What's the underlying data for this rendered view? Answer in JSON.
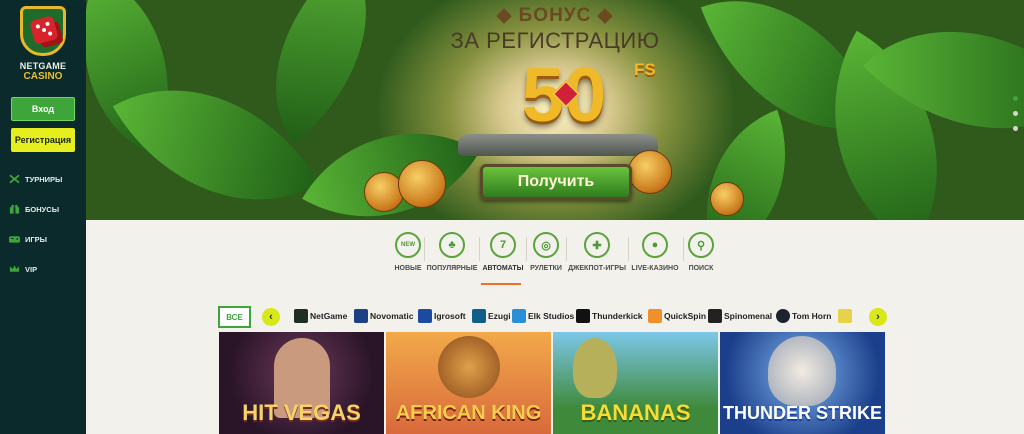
{
  "sidebar": {
    "logo_line1": "NETGAME",
    "logo_line2": "CASINO",
    "login_label": "Вход",
    "register_label": "Регистрация",
    "nav": [
      {
        "label": "ТУРНИРЫ",
        "icon": "tournament-icon"
      },
      {
        "label": "БОНУСЫ",
        "icon": "gift-icon"
      },
      {
        "label": "ИГРЫ",
        "icon": "games-icon"
      },
      {
        "label": "VIP",
        "icon": "crown-icon"
      }
    ]
  },
  "hero": {
    "line1": "◆ БОНУС ◆",
    "line2": "ЗА РЕГИСТРАЦИЮ",
    "amount": "50",
    "unit": "FS",
    "button_label": "Получить",
    "slides": 3,
    "active_slide": 1
  },
  "categories": [
    {
      "label": "НОВЫЕ",
      "icon": "new-icon",
      "glyph": "NEW"
    },
    {
      "label": "ПОПУЛЯРНЫЕ",
      "icon": "cherry-icon",
      "glyph": "♣"
    },
    {
      "label": "АВТОМАТЫ",
      "icon": "slot-icon",
      "glyph": "7"
    },
    {
      "label": "РУЛЕТКИ",
      "icon": "roulette-icon",
      "glyph": "◎"
    },
    {
      "label": "ДЖЕКПОТ-ИГРЫ",
      "icon": "jackpot-icon",
      "glyph": "✚"
    },
    {
      "label": "LIVE-КАЗИНО",
      "icon": "chips-icon",
      "glyph": "●"
    },
    {
      "label": "ПОИСК",
      "icon": "search-icon",
      "glyph": "⚲"
    }
  ],
  "active_category": "АВТОМАТЫ",
  "providers": {
    "all_label": "ВСЕ",
    "prev_glyph": "‹",
    "next_glyph": "›",
    "items": [
      {
        "label": "NetGame",
        "color": "#1f2d24"
      },
      {
        "label": "Novomatic",
        "color": "#1d3f86"
      },
      {
        "label": "Igrosoft",
        "color": "#1b4aa0"
      },
      {
        "label": "Ezugi",
        "color": "#0f5f8a"
      },
      {
        "label": "Elk Studios",
        "color": "#2b8fd8"
      },
      {
        "label": "Thunderkick",
        "color": "#111111"
      },
      {
        "label": "QuickSpin",
        "color": "#f0902a"
      },
      {
        "label": "Spinomenal",
        "color": "#222222"
      },
      {
        "label": "Tom Horn",
        "color": "#1b2430"
      }
    ]
  },
  "games": [
    {
      "title": "HIT VEGAS",
      "color": "#f4d36a"
    },
    {
      "title": "AFRICAN KING",
      "color": "#f6d04d"
    },
    {
      "title": "BANANAS",
      "color": "#f5dd35"
    },
    {
      "title": "THUNDER STRIKE",
      "color": "#ffffff"
    }
  ]
}
